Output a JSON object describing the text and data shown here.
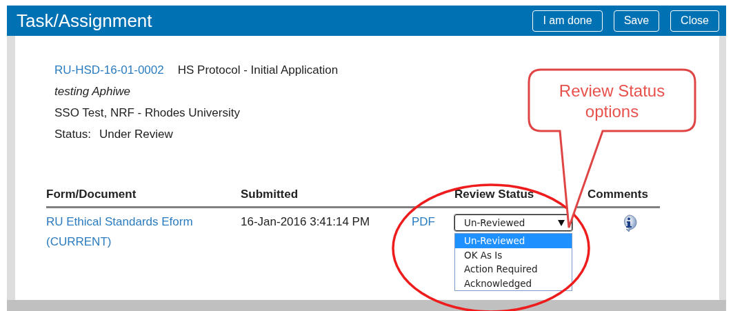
{
  "window": {
    "title": "Task/Assignment"
  },
  "buttons": [
    {
      "label": "I am done"
    },
    {
      "label": "Save"
    },
    {
      "label": "Close"
    }
  ],
  "record": {
    "id": "RU-HSD-16-01-0002",
    "type": "HS Protocol - Initial Application",
    "title": "testing Aphiwe",
    "owner": "SSO Test, NRF - Rhodes University",
    "status_label": "Status:",
    "status": "Under Review"
  },
  "table": {
    "columns": [
      "Form/Document",
      "Submitted",
      "Review Status",
      "Comments"
    ],
    "rows": [
      {
        "form": "RU Ethical Standards Eform (CURRENT)",
        "submitted": "16-Jan-2016 3:41:14 PM",
        "file": "PDF",
        "review_status": {
          "value": "Un-Reviewed",
          "expanded": true,
          "options": [
            {
              "label": "Un-Reviewed",
              "selected": true
            },
            {
              "label": "OK As Is",
              "selected": false
            },
            {
              "label": "Action Required",
              "selected": false
            },
            {
              "label": "Acknowledged",
              "selected": false
            }
          ]
        }
      }
    ]
  },
  "callout": {
    "text": "Review Status options"
  }
}
